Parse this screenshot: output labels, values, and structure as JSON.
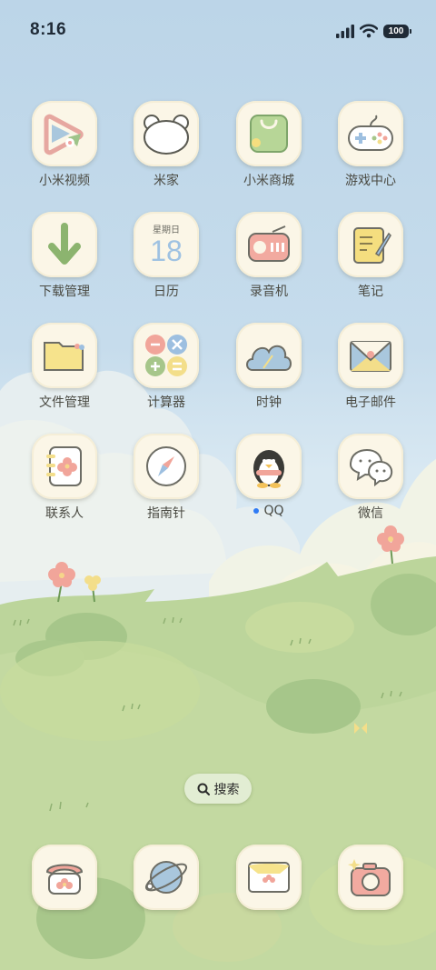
{
  "status_bar": {
    "time": "8:16",
    "battery": "100"
  },
  "apps": [
    {
      "label": "小米视频",
      "icon": "video-play-icon"
    },
    {
      "label": "米家",
      "icon": "bear-face-icon"
    },
    {
      "label": "小米商城",
      "icon": "shopping-bag-icon"
    },
    {
      "label": "游戏中心",
      "icon": "gamepad-icon"
    },
    {
      "label": "下载管理",
      "icon": "download-arrow-icon"
    },
    {
      "label": "日历",
      "icon": "calendar-icon",
      "calendar_weekday": "星期日",
      "calendar_day": "18"
    },
    {
      "label": "录音机",
      "icon": "radio-recorder-icon"
    },
    {
      "label": "笔记",
      "icon": "notepad-pencil-icon"
    },
    {
      "label": "文件管理",
      "icon": "folder-icon"
    },
    {
      "label": "计算器",
      "icon": "calculator-icon"
    },
    {
      "label": "时钟",
      "icon": "cloud-clock-icon"
    },
    {
      "label": "电子邮件",
      "icon": "envelope-icon"
    },
    {
      "label": "联系人",
      "icon": "contacts-book-icon"
    },
    {
      "label": "指南针",
      "icon": "compass-icon"
    },
    {
      "label": "QQ",
      "icon": "penguin-icon",
      "new_install_dot": true
    },
    {
      "label": "微信",
      "icon": "chat-bubbles-icon"
    }
  ],
  "search": {
    "label": "搜索"
  },
  "dock": [
    {
      "icon": "phone-icon"
    },
    {
      "icon": "planet-browser-icon"
    },
    {
      "icon": "message-envelope-icon"
    },
    {
      "icon": "camera-icon"
    }
  ],
  "colors": {
    "icon_bg": "#fbf6e7",
    "sky": "#bcd5e8",
    "grass": "#b9d397",
    "qq_dot": "#2f7bf5"
  }
}
